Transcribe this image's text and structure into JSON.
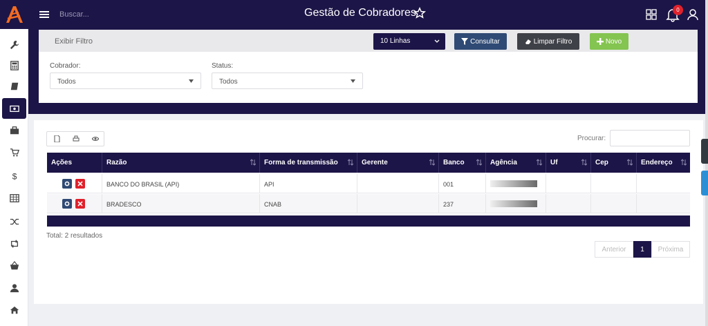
{
  "header": {
    "search_placeholder": "Buscar...",
    "title": "Gestão de Cobradores",
    "notification_count": "0"
  },
  "colors": {
    "brand_dark": "#1c1547",
    "accent_orange": "#f26b21",
    "primary_button": "#2f4a74",
    "secondary_button": "#3f4148",
    "success_button": "#84c451",
    "danger": "#e0212b"
  },
  "sidebar": {
    "items": [
      {
        "icon": "wrench-icon",
        "active": false
      },
      {
        "icon": "calculator-icon",
        "active": false
      },
      {
        "icon": "book-icon",
        "active": false
      },
      {
        "icon": "money-icon",
        "active": true
      },
      {
        "icon": "briefcase-icon",
        "active": false
      },
      {
        "icon": "cart-icon",
        "active": false
      },
      {
        "icon": "dollar-icon",
        "active": false
      },
      {
        "icon": "table-icon",
        "active": false
      },
      {
        "icon": "shuffle-icon",
        "active": false
      },
      {
        "icon": "retweet-icon",
        "active": false
      },
      {
        "icon": "basket-icon",
        "active": false
      },
      {
        "icon": "user-icon",
        "active": false
      },
      {
        "icon": "home-icon",
        "active": false
      }
    ]
  },
  "filter": {
    "toggle_label": "Exibir Filtro",
    "lines_select": "10 Linhas",
    "consultar_label": "Consultar",
    "limpar_label": "Limpar Filtro",
    "novo_label": "Novo",
    "cobrador_label": "Cobrador:",
    "cobrador_value": "Todos",
    "status_label": "Status:",
    "status_value": "Todos"
  },
  "table": {
    "procurar_label": "Procurar:",
    "columns": [
      "Ações",
      "Razão",
      "Forma de transmissão",
      "Gerente",
      "Banco",
      "Agência",
      "Uf",
      "Cep",
      "Endereço"
    ],
    "rows": [
      {
        "razao": "BANCO DO BRASIL (API)",
        "forma": "API",
        "gerente": "",
        "banco": "001"
      },
      {
        "razao": "BRADESCO",
        "forma": "CNAB",
        "gerente": "",
        "banco": "237"
      }
    ],
    "total_text": "Total: 2 resultados"
  },
  "pagination": {
    "prev_label": "Anterior",
    "current_page": "1",
    "next_label": "Próxima"
  }
}
